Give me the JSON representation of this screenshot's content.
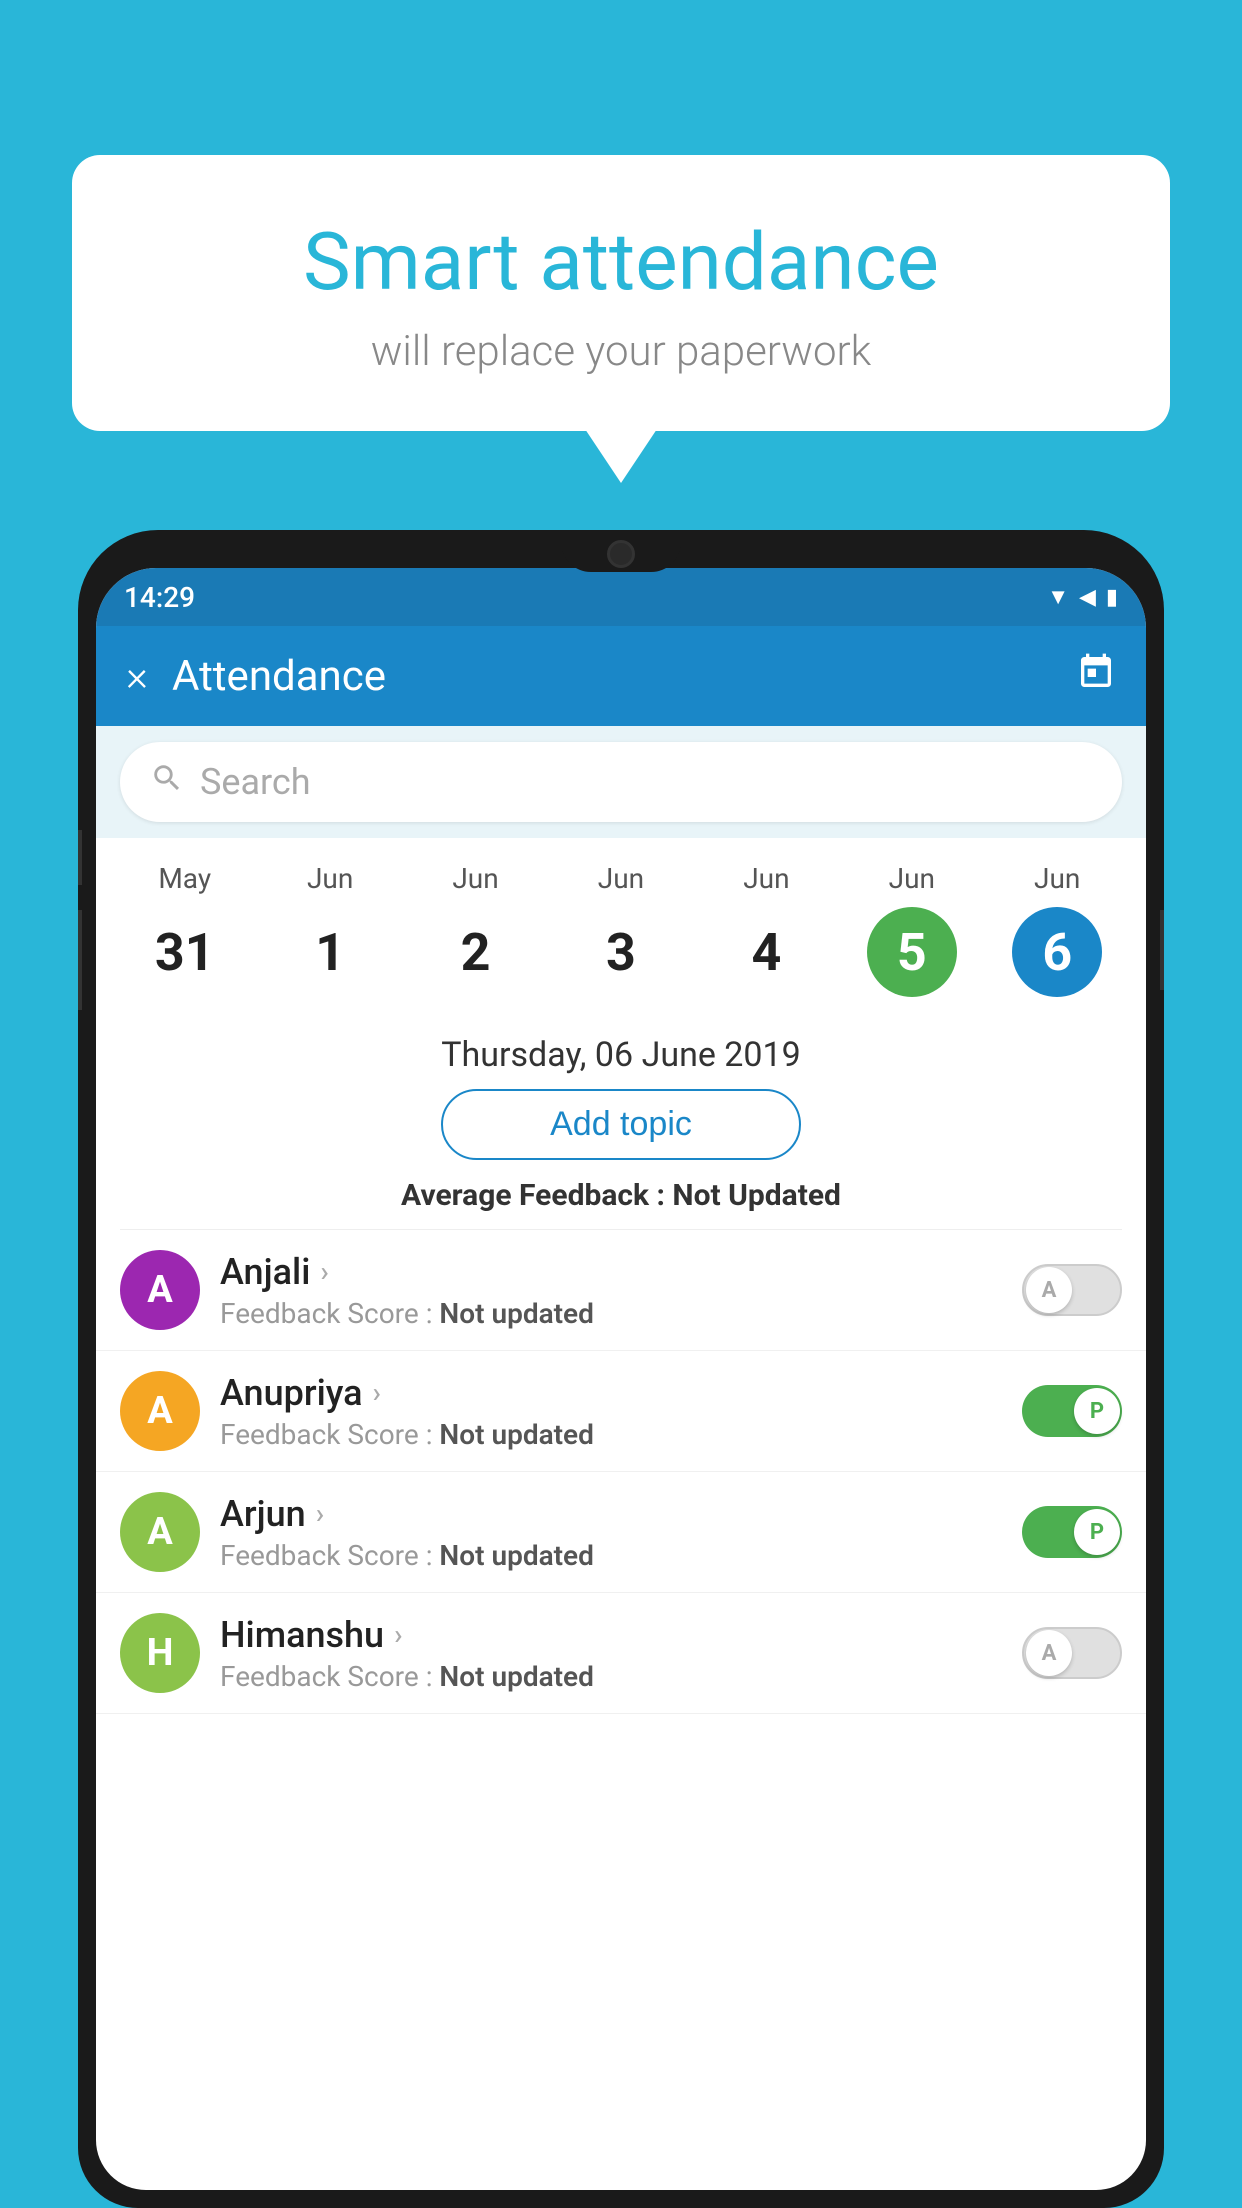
{
  "background_color": "#29b6d8",
  "speech_bubble": {
    "title": "Smart attendance",
    "subtitle": "will replace your paperwork"
  },
  "status_bar": {
    "time": "14:29",
    "icons": [
      "wifi",
      "signal",
      "battery"
    ]
  },
  "app_bar": {
    "title": "Attendance",
    "close_label": "×",
    "calendar_icon": "📅"
  },
  "search": {
    "placeholder": "Search"
  },
  "calendar": {
    "days": [
      {
        "month": "May",
        "date": "31",
        "style": "normal"
      },
      {
        "month": "Jun",
        "date": "1",
        "style": "normal"
      },
      {
        "month": "Jun",
        "date": "2",
        "style": "normal"
      },
      {
        "month": "Jun",
        "date": "3",
        "style": "normal"
      },
      {
        "month": "Jun",
        "date": "4",
        "style": "normal"
      },
      {
        "month": "Jun",
        "date": "5",
        "style": "green"
      },
      {
        "month": "Jun",
        "date": "6",
        "style": "blue"
      }
    ],
    "selected_date": "Thursday, 06 June 2019"
  },
  "add_topic_label": "Add topic",
  "avg_feedback_label": "Average Feedback :",
  "avg_feedback_value": "Not Updated",
  "students": [
    {
      "name": "Anjali",
      "avatar_letter": "A",
      "avatar_color": "#9c27b0",
      "feedback_label": "Feedback Score :",
      "feedback_value": "Not updated",
      "toggle": "off",
      "toggle_letter": "A"
    },
    {
      "name": "Anupriya",
      "avatar_letter": "A",
      "avatar_color": "#f5a623",
      "feedback_label": "Feedback Score :",
      "feedback_value": "Not updated",
      "toggle": "on",
      "toggle_letter": "P"
    },
    {
      "name": "Arjun",
      "avatar_letter": "A",
      "avatar_color": "#8bc34a",
      "feedback_label": "Feedback Score :",
      "feedback_value": "Not updated",
      "toggle": "on",
      "toggle_letter": "P"
    },
    {
      "name": "Himanshu",
      "avatar_letter": "H",
      "avatar_color": "#8bc34a",
      "feedback_label": "Feedback Score :",
      "feedback_value": "Not updated",
      "toggle": "off",
      "toggle_letter": "A"
    }
  ]
}
